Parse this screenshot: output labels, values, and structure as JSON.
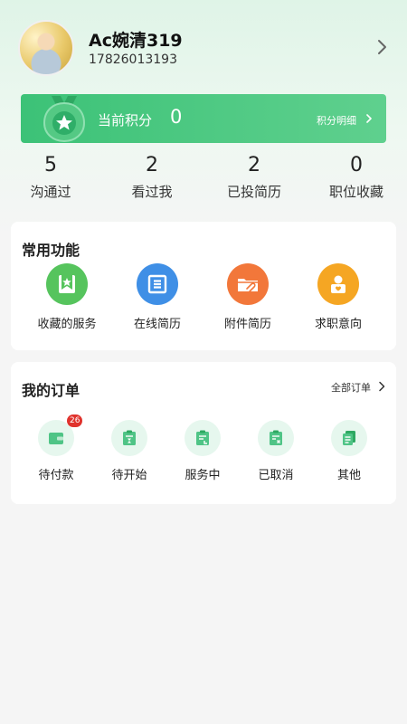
{
  "profile": {
    "name": "Ac婉清319",
    "phone": "17826013193"
  },
  "points": {
    "label": "当前积分",
    "value": "0",
    "detail_label": "积分明细"
  },
  "stats": [
    {
      "value": "5",
      "label": "沟通过"
    },
    {
      "value": "2",
      "label": "看过我"
    },
    {
      "value": "2",
      "label": "已投简历"
    },
    {
      "value": "0",
      "label": "职位收藏"
    }
  ],
  "functions": {
    "title": "常用功能",
    "items": [
      {
        "label": "收藏的服务",
        "icon": "bookmark-star-icon",
        "color": "#56c45d"
      },
      {
        "label": "在线简历",
        "icon": "resume-document-icon",
        "color": "#3f8fe6"
      },
      {
        "label": "附件简历",
        "icon": "folder-attachment-icon",
        "color": "#f2773a"
      },
      {
        "label": "求职意向",
        "icon": "user-heart-icon",
        "color": "#f5a623"
      }
    ]
  },
  "orders": {
    "title": "我的订单",
    "all_label": "全部订单",
    "items": [
      {
        "label": "待付款",
        "icon": "wallet-icon",
        "badge": "26"
      },
      {
        "label": "待开始",
        "icon": "hourglass-clipboard-icon"
      },
      {
        "label": "服务中",
        "icon": "progress-clipboard-icon"
      },
      {
        "label": "已取消",
        "icon": "cancel-clipboard-icon"
      },
      {
        "label": "其他",
        "icon": "stack-documents-icon"
      }
    ]
  },
  "colors": {
    "accent": "#3cc277",
    "order_icon_bg": "#e6f7ee",
    "badge": "#e0332d"
  }
}
